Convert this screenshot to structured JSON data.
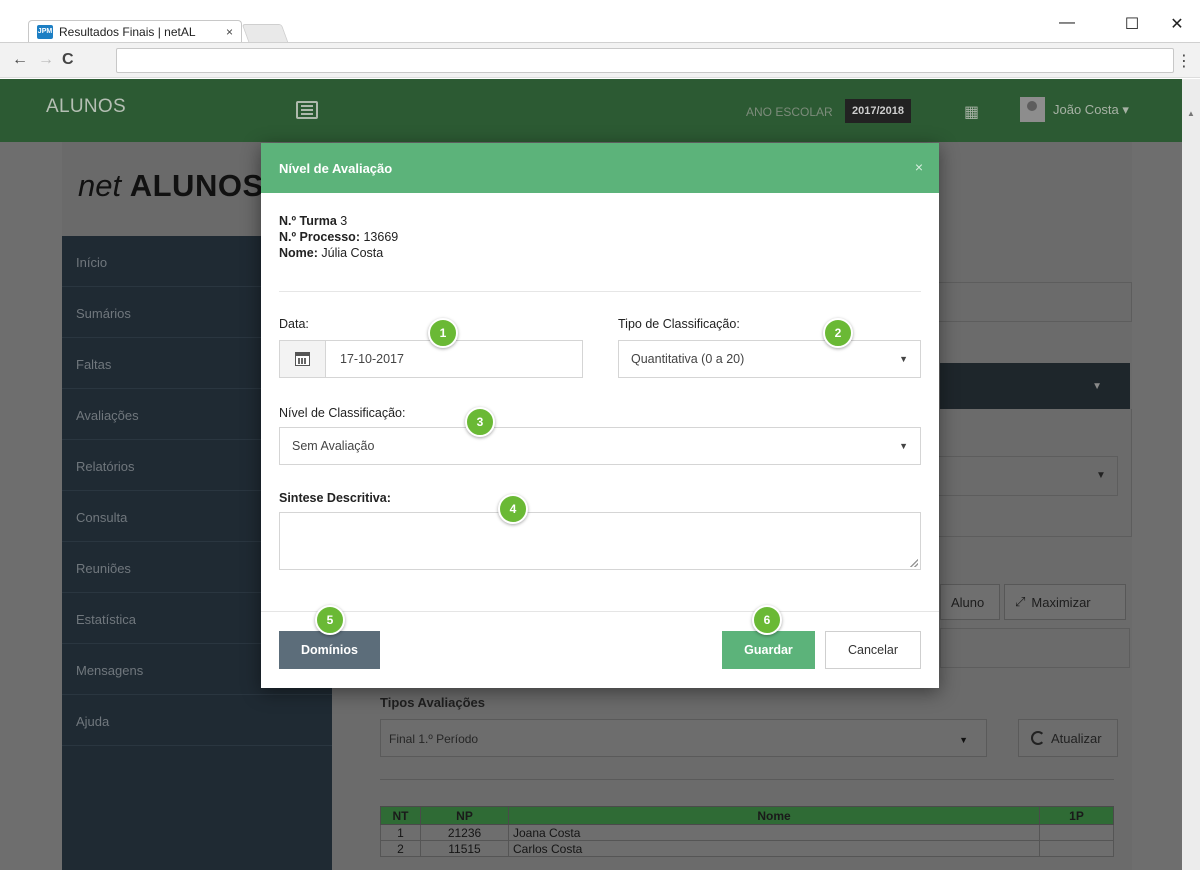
{
  "browser": {
    "tab_title": "Resultados Finais | netAL",
    "tab_close": "×",
    "favicon_text": "JPM",
    "window_minimize": "—",
    "window_maximize": "☐",
    "window_close": "✕",
    "back": "←",
    "forward": "→",
    "reload": "C",
    "menu": "⋮"
  },
  "topnav": {
    "brand": "ALUNOS",
    "year_label": "ANO ESCOLAR",
    "year_value": "2017/2018",
    "user_name": "João Costa ▾"
  },
  "sidebar": {
    "logo_net": "net",
    "logo_alunos": "ALUNOS",
    "items": [
      {
        "label": "Início"
      },
      {
        "label": "Sumários"
      },
      {
        "label": "Faltas"
      },
      {
        "label": "Avaliações"
      },
      {
        "label": "Relatórios"
      },
      {
        "label": "Consulta"
      },
      {
        "label": "Reuniões"
      },
      {
        "label": "Estatística"
      },
      {
        "label": "Mensagens"
      },
      {
        "label": "Ajuda"
      }
    ]
  },
  "background": {
    "aluno_btn": "Aluno",
    "maximizar_btn": "Maximizar",
    "tipos_label": "Tipos Avaliações",
    "tipos_value": "Final 1.º Período",
    "atualizar_btn": "Atualizar",
    "table": {
      "headers": [
        "NT",
        "NP",
        "Nome",
        "1P"
      ],
      "rows": [
        {
          "nt": "1",
          "np": "21236",
          "nome": "Joana Costa",
          "p1": ""
        },
        {
          "nt": "2",
          "np": "11515",
          "nome": "Carlos Costa",
          "p1": ""
        }
      ]
    }
  },
  "modal": {
    "title": "Nível de Avaliação",
    "close": "×",
    "turma_label": "N.º Turma",
    "turma_value": " 3",
    "processo_label": "N.º Processo:",
    "processo_value": " 13669",
    "nome_label": "Nome:",
    "nome_value": " Júlia Costa",
    "data_label": "Data:",
    "data_value": "17-10-2017",
    "tipo_label": "Tipo de Classificação:",
    "tipo_value": "Quantitativa (0 a 20)",
    "nivel_label": "Nível de Classificação:",
    "nivel_value": "Sem Avaliação",
    "sintese_label": "Sintese Descritiva:",
    "btn_dominios": "Domínios",
    "btn_guardar": "Guardar",
    "btn_cancelar": "Cancelar"
  },
  "badges": [
    "1",
    "2",
    "3",
    "4",
    "5",
    "6"
  ],
  "colors": {
    "accent_green": "#5cb37a",
    "nav_green": "#2c5a33",
    "badge_green": "#6ab935",
    "dominios_slate": "#5c6d7a"
  }
}
